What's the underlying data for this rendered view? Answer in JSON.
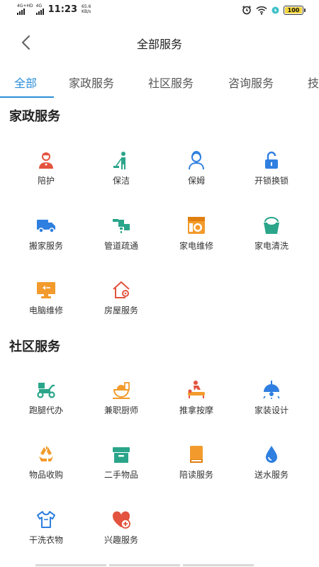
{
  "status_bar": {
    "sim1_label": "4G+HD",
    "sim2_label": "4G",
    "time": "11:23",
    "net_speed_value": "65.6",
    "net_speed_unit": "KB/s",
    "battery": "100"
  },
  "header": {
    "title": "全部服务"
  },
  "tabs": [
    {
      "label": "全部",
      "active": true
    },
    {
      "label": "家政服务"
    },
    {
      "label": "社区服务"
    },
    {
      "label": "咨询服务"
    },
    {
      "label": "技"
    }
  ],
  "sections": [
    {
      "title": "家政服务",
      "items": [
        {
          "label": "陪护",
          "icon": "nurse-icon"
        },
        {
          "label": "保洁",
          "icon": "cleaner-icon"
        },
        {
          "label": "保姆",
          "icon": "nanny-icon"
        },
        {
          "label": "开锁换锁",
          "icon": "lock-icon"
        },
        {
          "label": "搬家服务",
          "icon": "truck-icon"
        },
        {
          "label": "管道疏通",
          "icon": "pipe-icon"
        },
        {
          "label": "家电维修",
          "icon": "washer-icon"
        },
        {
          "label": "家电清洗",
          "icon": "bucket-icon"
        },
        {
          "label": "电脑维修",
          "icon": "monitor-icon"
        },
        {
          "label": "房屋服务",
          "icon": "house-gear-icon"
        }
      ]
    },
    {
      "title": "社区服务",
      "items": [
        {
          "label": "跑腿代办",
          "icon": "scooter-icon"
        },
        {
          "label": "兼职厨师",
          "icon": "chef-icon"
        },
        {
          "label": "推拿按摩",
          "icon": "massage-icon"
        },
        {
          "label": "家装设计",
          "icon": "lamp-icon"
        },
        {
          "label": "物品收购",
          "icon": "recycle-icon"
        },
        {
          "label": "二手物品",
          "icon": "box-icon"
        },
        {
          "label": "陪读服务",
          "icon": "book-icon"
        },
        {
          "label": "送水服务",
          "icon": "water-drop-icon"
        },
        {
          "label": "干洗衣物",
          "icon": "tshirt-icon"
        },
        {
          "label": "兴趣服务",
          "icon": "heart-plus-icon"
        }
      ]
    }
  ],
  "colors": {
    "accent": "#2b8fd8",
    "red": "#e3533f",
    "teal": "#2aa58a",
    "orange": "#f29b2c",
    "blue": "#2f7fe0"
  }
}
